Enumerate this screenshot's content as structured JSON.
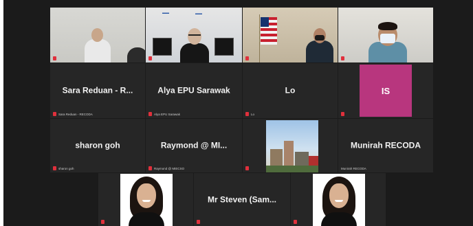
{
  "participants": [
    {
      "id": "p1",
      "display_name": "",
      "caption": "",
      "kind": "video"
    },
    {
      "id": "p2",
      "display_name": "",
      "caption": "",
      "kind": "video"
    },
    {
      "id": "p3",
      "display_name": "",
      "caption": "",
      "kind": "video"
    },
    {
      "id": "p4",
      "display_name": "",
      "caption": "",
      "kind": "video"
    },
    {
      "id": "p5",
      "display_name": "Sara Reduan - R...",
      "caption": "Sara Reduan - RECODA",
      "kind": "name"
    },
    {
      "id": "p6",
      "display_name": "Alya EPU Sarawak",
      "caption": "Alya EPU Sarawak",
      "kind": "name"
    },
    {
      "id": "p7",
      "display_name": "Lo",
      "caption": "Lo",
      "kind": "name"
    },
    {
      "id": "p8",
      "display_name": "",
      "initials": "IS",
      "caption": "",
      "kind": "initials"
    },
    {
      "id": "p9",
      "display_name": "sharon goh",
      "caption": "sharon goh",
      "kind": "name"
    },
    {
      "id": "p10",
      "display_name": "Raymond @ MI...",
      "caption": "Raymond @ MIECSO",
      "kind": "name"
    },
    {
      "id": "p11",
      "display_name": "",
      "caption": "",
      "kind": "video"
    },
    {
      "id": "p12",
      "display_name": "Munirah RECODA",
      "caption": "Munirah RECODA",
      "kind": "name"
    },
    {
      "id": "p13",
      "display_name": "",
      "caption": "",
      "kind": "video"
    },
    {
      "id": "p14",
      "display_name": "Mr Steven (Sam...",
      "caption": "",
      "kind": "name"
    },
    {
      "id": "p15",
      "display_name": "",
      "caption": "",
      "kind": "video"
    }
  ],
  "colors": {
    "background": "#1b1b1b",
    "tile": "#262626",
    "active_speaker_outline": "#c9e32a",
    "muted_mic": "#e0303c",
    "initials_avatar": "#b8367e"
  },
  "icons": {
    "muted": "mic-muted-icon"
  }
}
